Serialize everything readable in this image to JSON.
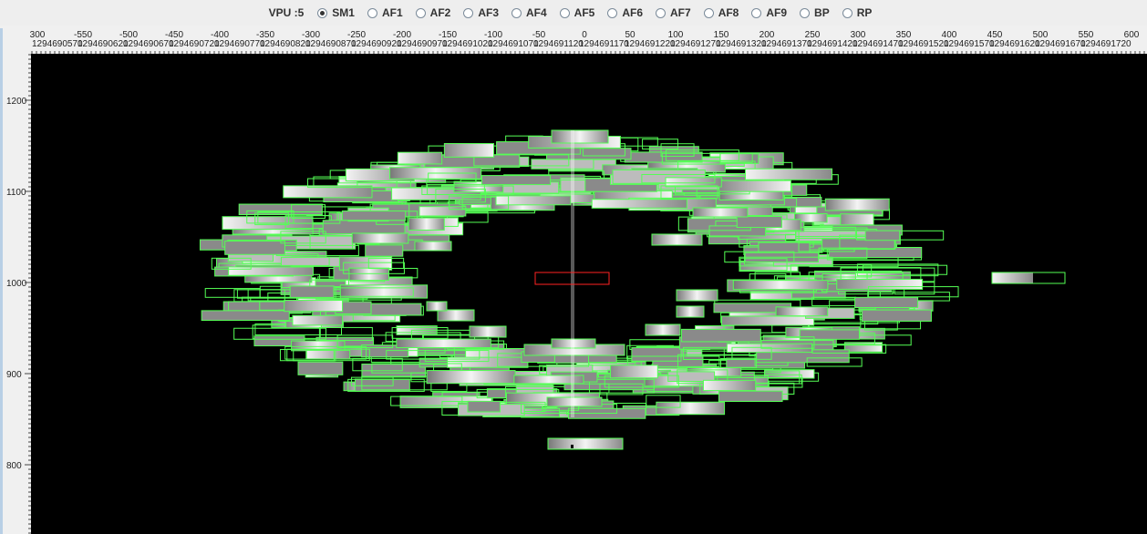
{
  "toolbar": {
    "vpu_label": "VPU :5",
    "options": [
      {
        "label": "SM1",
        "selected": true
      },
      {
        "label": "AF1",
        "selected": false
      },
      {
        "label": "AF2",
        "selected": false
      },
      {
        "label": "AF3",
        "selected": false
      },
      {
        "label": "AF4",
        "selected": false
      },
      {
        "label": "AF5",
        "selected": false
      },
      {
        "label": "AF6",
        "selected": false
      },
      {
        "label": "AF7",
        "selected": false
      },
      {
        "label": "AF8",
        "selected": false
      },
      {
        "label": "AF9",
        "selected": false
      },
      {
        "label": "BP",
        "selected": false
      },
      {
        "label": "RP",
        "selected": false
      }
    ]
  },
  "x_ruler": {
    "labels": [
      "300",
      "-550",
      "-500",
      "-450",
      "-400",
      "-350",
      "-300",
      "-250",
      "-200",
      "-150",
      "-100",
      "-50",
      "0",
      "50",
      "100",
      "150",
      "200",
      "250",
      "300",
      "350",
      "400",
      "450",
      "500",
      "550",
      "600"
    ],
    "sublabels": [
      "1294690570",
      "1294690620",
      "1294690670",
      "1294690720",
      "1294690770",
      "1294690820",
      "1294690870",
      "1294690920",
      "1294690970",
      "1294691020",
      "1294691070",
      "1294691120",
      "1294691170",
      "1294691220",
      "1294691270",
      "1294691320",
      "1294691370",
      "1294691420",
      "1294691470",
      "1294691520",
      "1294691570",
      "1294691620",
      "1294691670",
      "1294691720"
    ]
  },
  "y_ruler": {
    "labels": [
      "1200",
      "1100",
      "1000",
      "900",
      "800"
    ]
  },
  "colors": {
    "detection_box": "#55ff55",
    "selection_box": "#ff2222",
    "view_background": "#000000",
    "ruler_background": "#f0f0f0"
  }
}
